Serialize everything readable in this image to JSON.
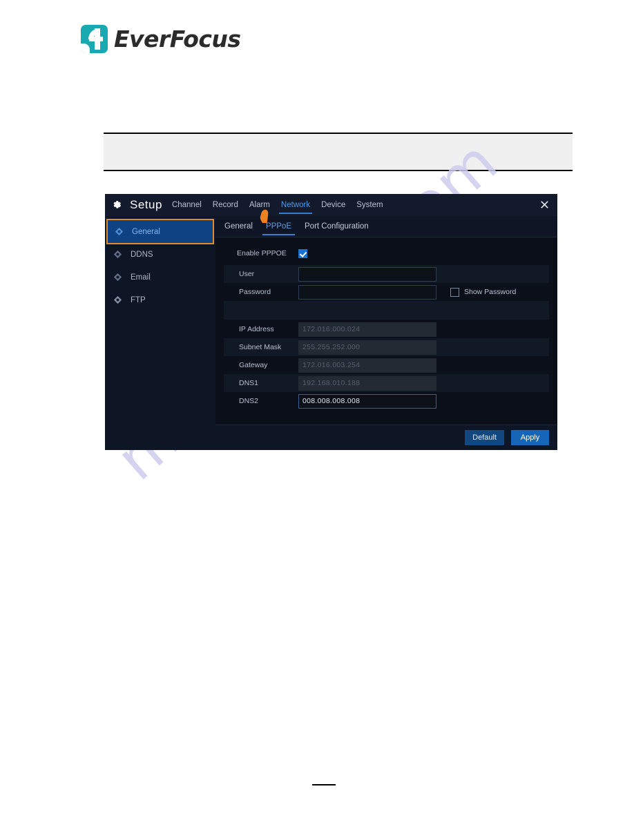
{
  "brand": {
    "name": "EverFocus",
    "logo_color": "#18aab0",
    "wordmark_color": "#2b2b2b"
  },
  "watermark": {
    "text": "manualslib.com",
    "color": "#cdcdef"
  },
  "note_box": {
    "text": ""
  },
  "dvr": {
    "titlebar": {
      "gear_icon": "gear-icon",
      "title": "Setup",
      "close_icon": "close-icon",
      "menu": [
        {
          "label": "Channel",
          "active": false
        },
        {
          "label": "Record",
          "active": false
        },
        {
          "label": "Alarm",
          "active": false
        },
        {
          "label": "Network",
          "active": true
        },
        {
          "label": "Device",
          "active": false
        },
        {
          "label": "System",
          "active": false
        }
      ]
    },
    "sidebar": {
      "items": [
        {
          "label": "General",
          "icon": "diamond-icon",
          "selected": true
        },
        {
          "label": "DDNS",
          "icon": "diamond-icon",
          "selected": false
        },
        {
          "label": "Email",
          "icon": "diamond-icon",
          "selected": false
        },
        {
          "label": "FTP",
          "icon": "diamond-icon",
          "selected": false
        }
      ],
      "selected_border_color": "#e08a2e",
      "selected_bg_color": "#0f4283"
    },
    "subtabs": [
      {
        "label": "General",
        "active": false
      },
      {
        "label": "PPPoE",
        "active": true
      },
      {
        "label": "Port Configuration",
        "active": false
      }
    ],
    "cursor": {
      "icon": "hand-pointer-cursor",
      "color": "#ef8024"
    },
    "form": {
      "enable_pppoe": {
        "label": "Enable PPPOE",
        "checked": true
      },
      "user": {
        "label": "User",
        "value": "",
        "placeholder": ""
      },
      "password": {
        "label": "Password",
        "value": "",
        "placeholder": ""
      },
      "show_password": {
        "label": "Show Password",
        "checked": false
      },
      "ip_address": {
        "label": "IP Address",
        "value": "172.016.000.024",
        "readonly": true
      },
      "subnet_mask": {
        "label": "Subnet Mask",
        "value": "255.255.252.000",
        "readonly": true
      },
      "gateway": {
        "label": "Gateway",
        "value": "172.016.003.254",
        "readonly": true
      },
      "dns1": {
        "label": "DNS1",
        "value": "192.168.010.188",
        "readonly": true
      },
      "dns2": {
        "label": "DNS2",
        "value": "008.008.008.008",
        "readonly": false
      }
    },
    "footer": {
      "default_label": "Default",
      "apply_label": "Apply"
    }
  }
}
